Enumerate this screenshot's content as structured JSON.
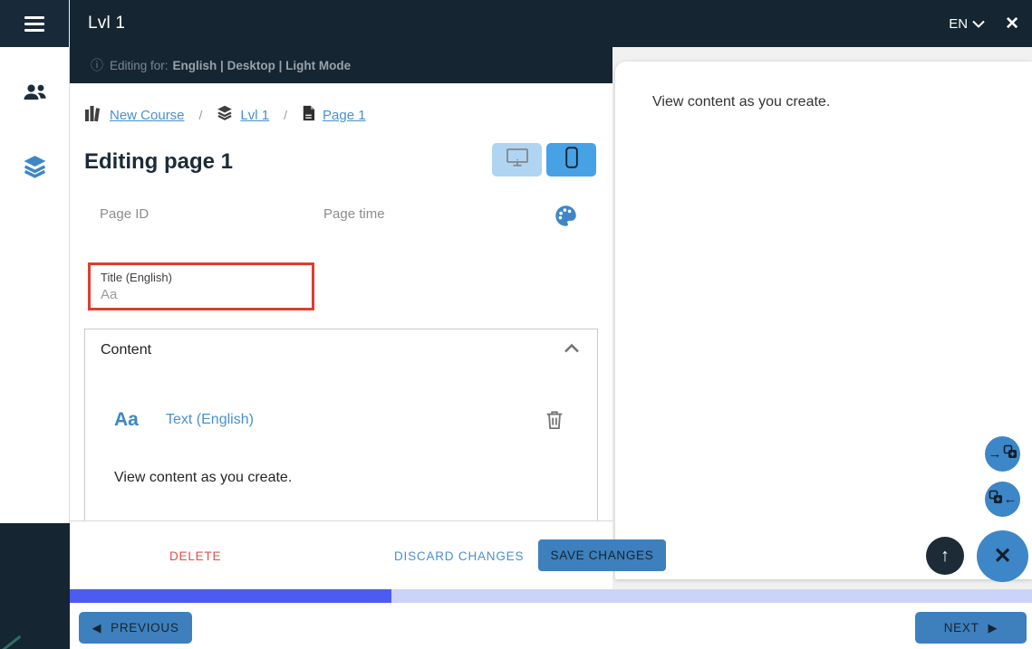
{
  "header": {
    "title": "Lvl 1",
    "language": "EN",
    "editing_for_prefix": "Editing for:",
    "editing_for_value": "English | Desktop | Light Mode"
  },
  "breadcrumb": {
    "separator": "/",
    "items": [
      {
        "label": "New Course",
        "icon": "course-icon"
      },
      {
        "label": "Lvl 1",
        "icon": "layers-icon"
      },
      {
        "label": "Page 1",
        "icon": "page-icon"
      }
    ]
  },
  "editor": {
    "heading": "Editing page 1",
    "page_id_label": "Page ID",
    "page_time_label": "Page time",
    "title_field": {
      "label": "Title (English)",
      "placeholder": "Aa"
    },
    "content_section": {
      "title": "Content",
      "block": {
        "type_icon_text": "Aa",
        "type_label": "Text (English)",
        "body": "View content as you create."
      }
    }
  },
  "actions": {
    "delete": "DELETE",
    "discard": "DISCARD CHANGES",
    "save": "SAVE CHANGES"
  },
  "preview": {
    "text": "View content as you create."
  },
  "footer": {
    "previous": "PREVIOUS",
    "next": "NEXT",
    "progress_percent": 33.4
  },
  "icons": {
    "info": "ⓘ",
    "close": "✕",
    "arrow_right": "→",
    "arrow_left": "←",
    "arrow_up": "↑",
    "triangle_left": "◀",
    "triangle_right": "▶"
  },
  "colors": {
    "dark_navy": "#152531",
    "button_blue": "#3d80bd",
    "active_device_blue": "#47a2e5",
    "inactive_device_blue": "#b0d5f2",
    "link_blue": "#4a8fd0",
    "icon_blue": "#3e86c7",
    "delete_red": "#e0504b",
    "error_border_red": "#e23b2e",
    "progress_fill": "#4c5bf0",
    "progress_track": "#ccd3f9"
  }
}
